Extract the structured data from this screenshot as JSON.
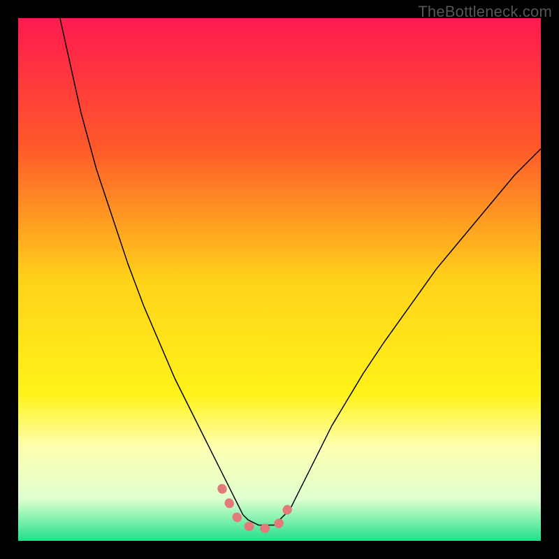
{
  "watermark": "TheBottleneck.com",
  "chart_data": {
    "type": "line",
    "title": "",
    "xlabel": "",
    "ylabel": "",
    "xlim": [
      0,
      100
    ],
    "ylim": [
      0,
      100
    ],
    "gradient": {
      "stops": [
        {
          "offset": 0.0,
          "color": "#ff1a4f"
        },
        {
          "offset": 0.25,
          "color": "#ff5a2a"
        },
        {
          "offset": 0.5,
          "color": "#ffd21a"
        },
        {
          "offset": 0.72,
          "color": "#fff31a"
        },
        {
          "offset": 0.82,
          "color": "#fdffb0"
        },
        {
          "offset": 0.92,
          "color": "#dfffd0"
        },
        {
          "offset": 1.0,
          "color": "#21e08a"
        }
      ]
    },
    "series": [
      {
        "name": "curve_left_to_right",
        "stroke": "#000000",
        "stroke_width": 1.5,
        "x": [
          8,
          10,
          12,
          15,
          18,
          21,
          24,
          27,
          30,
          33,
          36,
          38,
          40,
          41,
          42,
          43,
          44,
          46,
          48,
          49,
          50,
          52,
          54,
          56,
          58,
          60,
          63,
          66,
          70,
          75,
          80,
          85,
          90,
          95,
          100
        ],
        "y": [
          100,
          91,
          82,
          71,
          62,
          53,
          45,
          38,
          31,
          25,
          19,
          15,
          11,
          9,
          7,
          5,
          4,
          3,
          3,
          3,
          4,
          6,
          10,
          14,
          18,
          22,
          27,
          32,
          38,
          45,
          52,
          58,
          64,
          70,
          75
        ]
      }
    ],
    "highlight": {
      "name": "min_region_marker",
      "stroke": "#e37a7a",
      "stroke_width": 13,
      "x": [
        39,
        41.5,
        43,
        46,
        49,
        50.5,
        52.8
      ],
      "y": [
        10,
        5.0,
        3.0,
        2.4,
        2.4,
        4.0,
        8.5
      ]
    }
  }
}
